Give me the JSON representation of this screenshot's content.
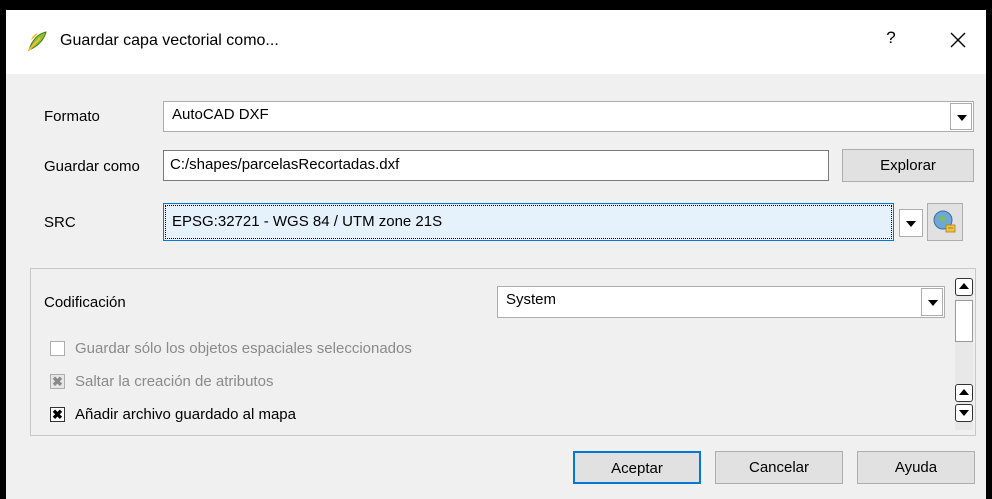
{
  "window": {
    "title": "Guardar capa vectorial como...",
    "help": "?",
    "close": "✕"
  },
  "form": {
    "format_label": "Formato",
    "format_value": "AutoCAD DXF",
    "save_as_label": "Guardar como",
    "save_as_value": "C:/shapes/parcelasRecortadas.dxf",
    "browse_label": "Explorar",
    "crs_label": "SRC",
    "crs_value": "EPSG:32721 - WGS 84 / UTM zone 21S"
  },
  "options": {
    "encoding_label": "Codificación",
    "encoding_value": "System",
    "checkboxes": [
      {
        "label": "Guardar sólo los objetos espaciales seleccionados",
        "state": "unchecked-disabled"
      },
      {
        "label": "Saltar la creación de atributos",
        "state": "checked-disabled"
      },
      {
        "label": "Añadir archivo guardado al mapa",
        "state": "checked"
      }
    ]
  },
  "buttons": {
    "accept": "Aceptar",
    "cancel": "Cancelar",
    "help": "Ayuda"
  },
  "icons": {
    "app": "qgis-leaf-icon",
    "crs": "globe-crs-icon"
  }
}
